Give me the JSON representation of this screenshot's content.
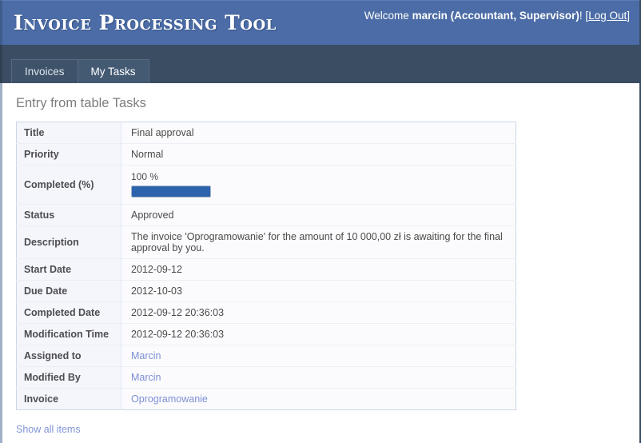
{
  "header": {
    "app_title": "Invoice Processing Tool",
    "welcome_prefix": "Welcome",
    "user_name": "marcin (Accountant, Supervisor)",
    "welcome_suffix": "!",
    "bracket_open": "[",
    "logout_label": "Log Out",
    "bracket_close": "]",
    "accent_color": "#4b6ca6"
  },
  "nav": {
    "tabs": [
      {
        "label": "Invoices",
        "active": true
      },
      {
        "label": "My Tasks",
        "active": false
      }
    ],
    "bar_color": "#3a4d63"
  },
  "main": {
    "page_title": "Entry from table Tasks",
    "show_all_label": "Show all items",
    "progress": {
      "percent_text": "100 %",
      "percent_value": 100,
      "fill_color": "#2d62ad"
    },
    "rows": [
      {
        "label": "Title",
        "value": "Final approval",
        "type": "text"
      },
      {
        "label": "Priority",
        "value": "Normal",
        "type": "text"
      },
      {
        "label": "Completed (%)",
        "value": "100 %",
        "type": "progress"
      },
      {
        "label": "Status",
        "value": "Approved",
        "type": "text"
      },
      {
        "label": "Description",
        "value": "The invoice 'Oprogramowanie' for the amount of 10 000,00 zł is awaiting for the final approval by you.",
        "type": "text"
      },
      {
        "label": "Start Date",
        "value": "2012-09-12",
        "type": "text"
      },
      {
        "label": "Due Date",
        "value": "2012-10-03",
        "type": "text"
      },
      {
        "label": "Completed Date",
        "value": "2012-09-12 20:36:03",
        "type": "text"
      },
      {
        "label": "Modification Time",
        "value": "2012-09-12 20:36:03",
        "type": "text"
      },
      {
        "label": "Assigned to",
        "value": "Marcin",
        "type": "link"
      },
      {
        "label": "Modified By",
        "value": "Marcin",
        "type": "link"
      },
      {
        "label": "Invoice",
        "value": "Oprogramowanie",
        "type": "link"
      }
    ]
  }
}
